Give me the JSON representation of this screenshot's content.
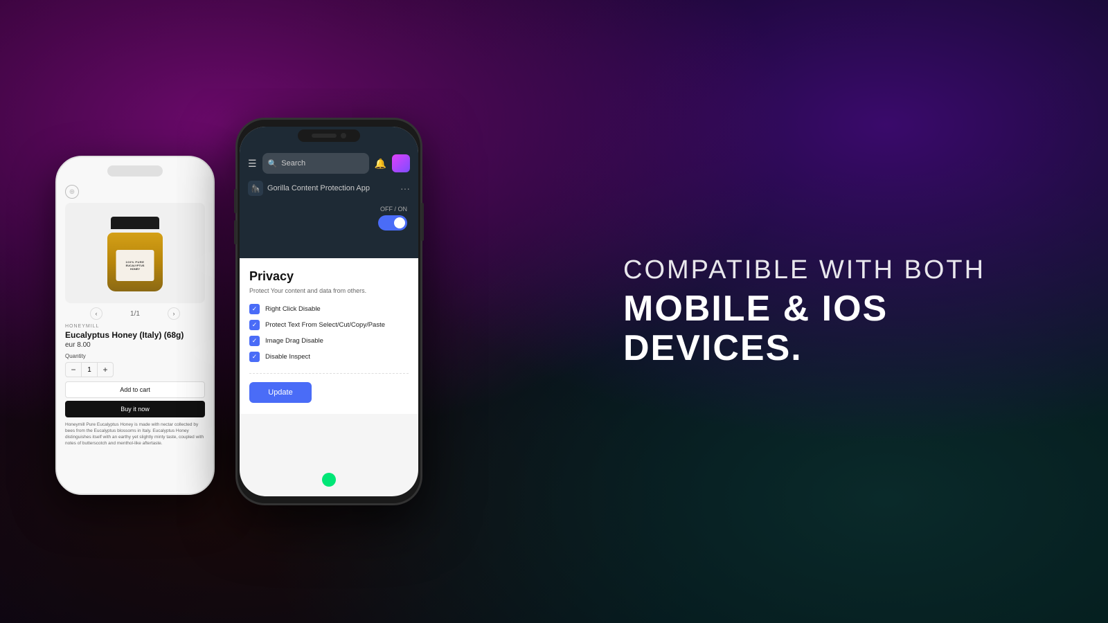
{
  "background": {
    "color1": "#6b0a6b",
    "color2": "#3a0a6b",
    "color3": "#0a2a2a"
  },
  "phone_left": {
    "brand": "HONEYMILL",
    "product_name": "Eucalyptus Honey (Italy) (68g)",
    "price": "eur 8.00",
    "quantity_label": "Quantity",
    "quantity_value": "1",
    "nav_counter": "1/1",
    "add_to_cart": "Add to cart",
    "buy_now": "Buy it now",
    "description": "Honeymill Pure Eucalyptus Honey is made with nectar collected by bees from the Eucalyptus blossoms in Italy. Eucalyptus Honey distinguishes itself with an earthy yet slightly minty taste, coupled with notes of butterscotch and menthol-like aftertaste.",
    "honey_jar_text": "100% PURE\nEUCALYPTUS HONEY"
  },
  "phone_right": {
    "search_placeholder": "Search",
    "app_title": "Gorilla Content Protection App",
    "toggle_label": "OFF / ON",
    "toggle_state": "ON",
    "privacy_title": "Privacy",
    "privacy_subtitle": "Protect Your content and data from others.",
    "checkboxes": [
      {
        "label": "Right Click Disable",
        "checked": true
      },
      {
        "label": "Protect Text From Select/Cut/Copy/Paste",
        "checked": true
      },
      {
        "label": "Image Drag Disable",
        "checked": true
      },
      {
        "label": "Disable Inspect",
        "checked": true
      }
    ],
    "update_button": "Update"
  },
  "tagline": {
    "line1": "COMPATIBLE WITH BOTH",
    "line2": "MOBILE & IOS DEVICES."
  }
}
